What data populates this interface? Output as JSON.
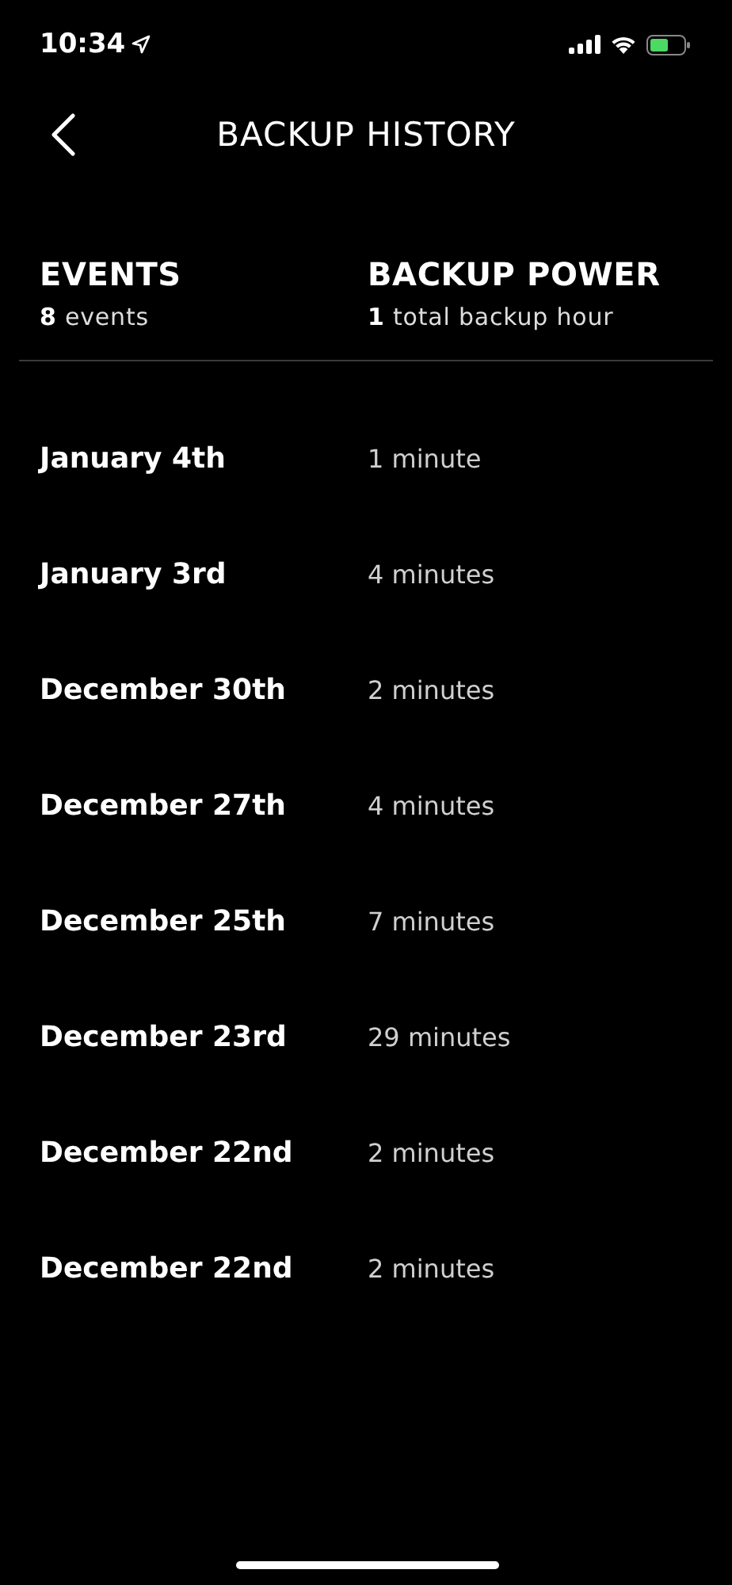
{
  "status_bar": {
    "time": "10:34"
  },
  "header": {
    "title": "BACKUP HISTORY"
  },
  "summary": [
    {
      "heading": "EVENTS",
      "detail": "**8** events"
    },
    {
      "heading": "BACKUP POWER",
      "detail": "**1** total backup hour"
    }
  ],
  "events": [
    {
      "date": "January 4th",
      "duration": "1 minute"
    },
    {
      "date": "January 3rd",
      "duration": "4 minutes"
    },
    {
      "date": "December 30th",
      "duration": "2 minutes"
    },
    {
      "date": "December 27th",
      "duration": "4 minutes"
    },
    {
      "date": "December 25th",
      "duration": "7 minutes"
    },
    {
      "date": "December 23rd",
      "duration": "29 minutes"
    },
    {
      "date": "December 22nd",
      "duration": "2 minutes"
    },
    {
      "date": "December 22nd",
      "duration": "2 minutes"
    }
  ]
}
